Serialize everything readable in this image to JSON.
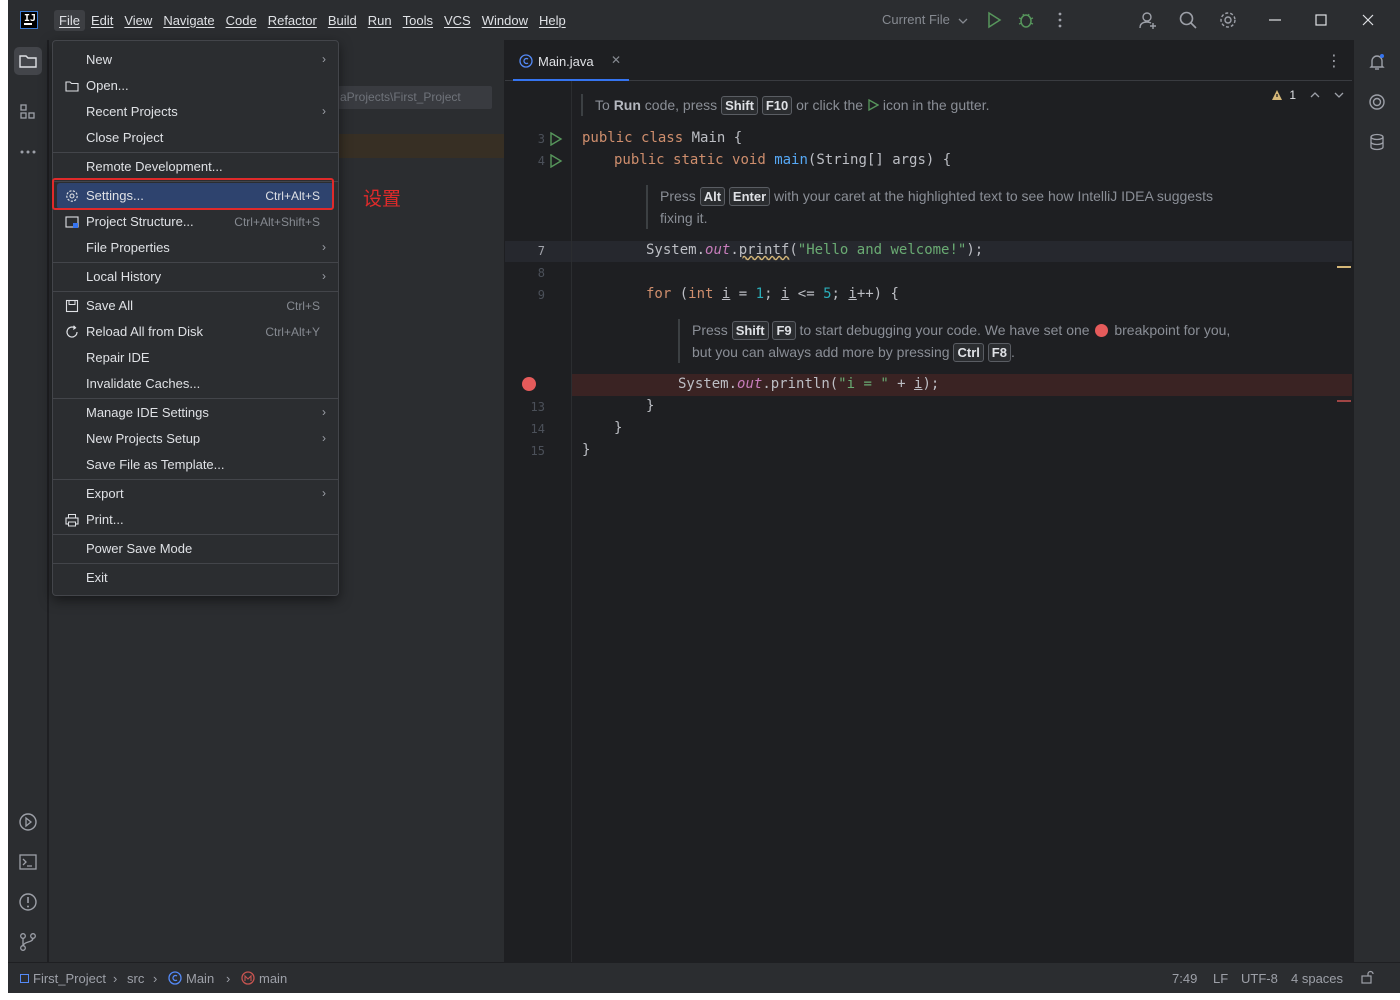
{
  "menubar": {
    "items": [
      "File",
      "Edit",
      "View",
      "Navigate",
      "Code",
      "Refactor",
      "Build",
      "Run",
      "Tools",
      "VCS",
      "Window",
      "Help"
    ]
  },
  "toolbar": {
    "run_config": "Current File"
  },
  "app_logo_text": "IJ",
  "project_panel": {
    "path_hint": "aProjects\\First_Project"
  },
  "file_menu": {
    "items": [
      {
        "label": "New",
        "submenu": true
      },
      {
        "label": "Open...",
        "icon": "folder-icon"
      },
      {
        "label": "Recent Projects",
        "submenu": true
      },
      {
        "label": "Close Project"
      },
      {
        "label": "Remote Development..."
      },
      {
        "label": "Settings...",
        "shortcut": "Ctrl+Alt+S",
        "icon": "gear-icon",
        "selected": true
      },
      {
        "label": "Project Structure...",
        "shortcut": "Ctrl+Alt+Shift+S",
        "icon": "project-structure-icon"
      },
      {
        "label": "File Properties",
        "submenu": true
      },
      {
        "label": "Local History",
        "submenu": true
      },
      {
        "label": "Save All",
        "shortcut": "Ctrl+S",
        "icon": "save-icon"
      },
      {
        "label": "Reload All from Disk",
        "shortcut": "Ctrl+Alt+Y",
        "icon": "reload-icon"
      },
      {
        "label": "Repair IDE"
      },
      {
        "label": "Invalidate Caches..."
      },
      {
        "label": "Manage IDE Settings",
        "submenu": true
      },
      {
        "label": "New Projects Setup",
        "submenu": true
      },
      {
        "label": "Save File as Template..."
      },
      {
        "label": "Export",
        "submenu": true
      },
      {
        "label": "Print...",
        "icon": "print-icon"
      },
      {
        "label": "Power Save Mode"
      },
      {
        "label": "Exit"
      }
    ]
  },
  "annotation": "设置",
  "editor": {
    "tab_label": "Main.java",
    "warning_count": "1",
    "line_numbers": [
      "3",
      "4",
      "7",
      "8",
      "9",
      "13",
      "14",
      "15"
    ],
    "hint_run": {
      "a": "To ",
      "b": "Run",
      "c": " code, press ",
      "k1": "Shift",
      "k2": "F10",
      "d": " or click the ",
      "e": " icon in the gutter."
    },
    "hint_alt": {
      "a": "Press ",
      "k1": "Alt",
      "k2": "Enter",
      "b": " with your caret at the highlighted text to see how IntelliJ IDEA suggests",
      "c": "fixing it."
    },
    "hint_debug": {
      "a": "Press ",
      "k1": "Shift",
      "k2": "F9",
      "b": " to start debugging your code. We have set one ",
      "c": " breakpoint for you,",
      "d": "but you can always add more by pressing ",
      "k3": "Ctrl",
      "k4": "F8",
      "e": "."
    },
    "code": {
      "l3_kw1": "public",
      "l3_kw2": "class",
      "l3_rest": " Main {",
      "l4_kw1": "public",
      "l4_kw2": "static",
      "l4_kw3": "void",
      "l4_fn": "main",
      "l4_rest": "(String[] args) {",
      "l7_a": "System.",
      "l7_out": "out",
      "l7_dot": ".",
      "l7_fn": "printf",
      "l7_p1": "(",
      "l7_str": "\"Hello and welcome!\"",
      "l7_end": ");",
      "l9_kw": "for",
      "l9_a": " (",
      "l9_int": "int",
      "l9_sp": " ",
      "l9_i1": "i",
      "l9_eq": " = ",
      "l9_n1": "1",
      "l9_sc": "; ",
      "l9_i2": "i",
      "l9_le": " <= ",
      "l9_n2": "5",
      "l9_sc2": "; ",
      "l9_i3": "i",
      "l9_pp": "++) {",
      "l12_a": "System.",
      "l12_out": "out",
      "l12_b": ".println(",
      "l12_str": "\"i = \"",
      "l12_c": " + ",
      "l12_i": "i",
      "l12_d": ");",
      "close_brace": "}"
    }
  },
  "statusbar": {
    "crumbs": [
      "First_Project",
      "src",
      "Main",
      "main"
    ],
    "position": "7:49",
    "line_sep": "LF",
    "encoding": "UTF-8",
    "indent": "4 spaces"
  },
  "colors": {
    "accent": "#3574f0",
    "highlight_box": "#e02a2a",
    "selected_item": "#2e436e",
    "breakpoint": "#e55b5b"
  }
}
